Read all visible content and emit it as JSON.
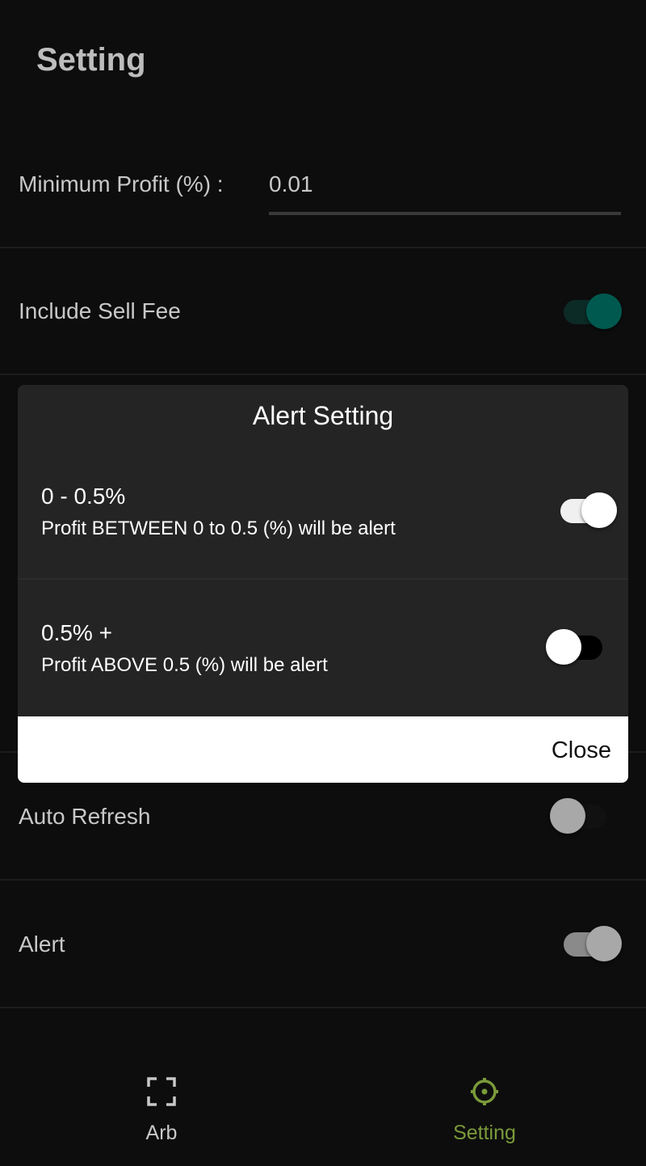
{
  "header": {
    "title": "Setting"
  },
  "settings": {
    "min_profit_label": "Minimum Profit (%) :",
    "min_profit_value": "0.01",
    "include_sell_fee": {
      "label": "Include Sell Fee",
      "on": true
    },
    "auto_refresh": {
      "label": "Auto Refresh",
      "on": false
    },
    "alert": {
      "label": "Alert",
      "on": true
    }
  },
  "modal": {
    "title": "Alert Setting",
    "items": [
      {
        "title": "0 - 0.5%",
        "subtitle": "Profit BETWEEN 0 to 0.5 (%) will be alert",
        "on": true
      },
      {
        "title": "0.5% +",
        "subtitle": "Profit ABOVE 0.5 (%) will be alert",
        "on": false
      }
    ],
    "close_label": "Close"
  },
  "nav": {
    "items": [
      {
        "label": "Arb",
        "icon": "scan-frame-icon",
        "active": false
      },
      {
        "label": "Setting",
        "icon": "gear-icon",
        "active": true
      }
    ]
  },
  "colors": {
    "accent": "#7a9a3a",
    "teal": "#00594f",
    "background": "#0d0d0d"
  }
}
